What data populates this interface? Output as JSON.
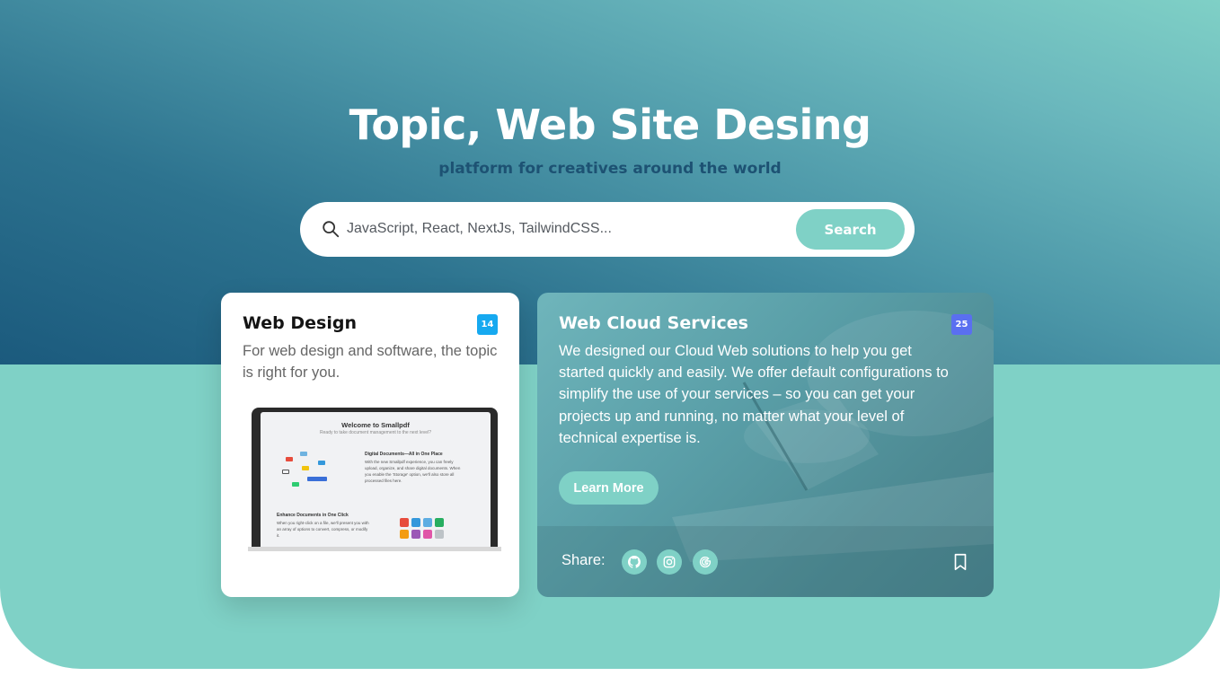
{
  "hero": {
    "title": "Topic, Web Site Desing",
    "subtitle": "platform for creatives around the world"
  },
  "search": {
    "placeholder": "JavaScript, React, NextJs, TailwindCSS...",
    "value": "",
    "button_label": "Search",
    "icon": "search-icon"
  },
  "cards": [
    {
      "title": "Web Design",
      "badge": "14",
      "badge_color": "#16a9f0",
      "description": "For web design and software, the topic is right for you.",
      "image": {
        "screen_title": "Welcome to Smallpdf",
        "screen_subtitle": "Ready to take document management to the next level?",
        "heading1": "Digital Documents—All in One Place",
        "text1": "With the new Smallpdf experience, you can freely upload, organize, and share digital documents. When you enable the 'Storage' option, we'll also store all processed files here.",
        "heading2": "Enhance Documents in One Click",
        "text2": "When you right-click on a file, we'll present you with an array of options to convert, compress, or modify it."
      }
    },
    {
      "title": "Web Cloud Services",
      "badge": "25",
      "badge_color": "#5a6ff0",
      "description": "We designed our Cloud Web solutions to help you get started quickly and easily. We offer default configurations to simplify the use of your services – so you can get your projects up and running, no matter what your level of technical expertise is.",
      "button_label": "Learn More",
      "share_label": "Share:",
      "social_icons": [
        "github-icon",
        "instagram-icon",
        "google-icon"
      ],
      "bookmark_icon": "bookmark-icon"
    }
  ],
  "colors": {
    "accent": "#7fd1c6",
    "hero_dark": "#1b5a7d",
    "subtitle": "#1d5273"
  }
}
